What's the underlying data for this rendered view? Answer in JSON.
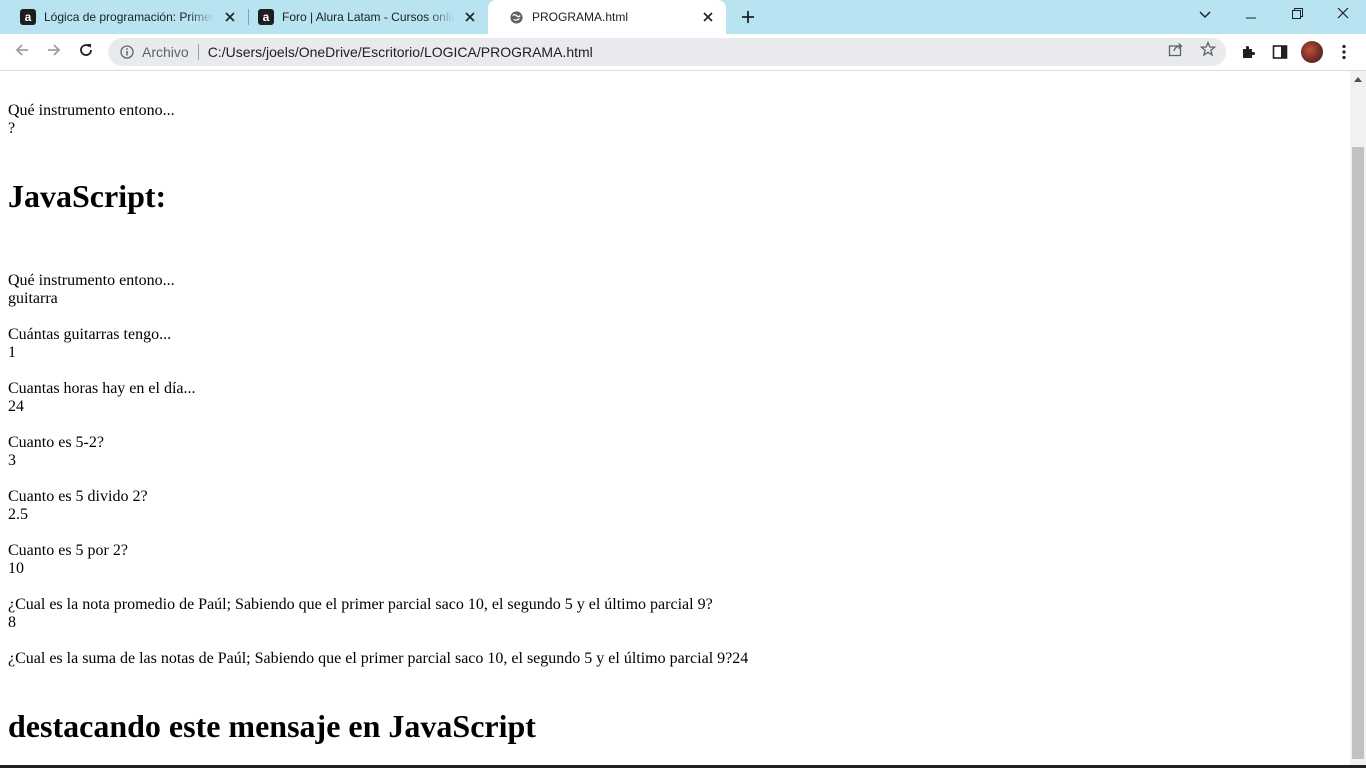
{
  "browser": {
    "tabs": [
      {
        "title": "Lógica de programación: Primeros pasos",
        "favicon": "alura-icon",
        "active": false
      },
      {
        "title": "Foro | Alura Latam - Cursos online",
        "favicon": "alura-icon",
        "active": false
      },
      {
        "title": "PROGRAMA.html",
        "favicon": "globe-icon",
        "active": true
      }
    ],
    "favicon_letter": "a",
    "address": {
      "chip": "Archivo",
      "url": "C:/Users/joels/OneDrive/Escritorio/LOGICA/PROGRAMA.html"
    },
    "colors": {
      "tabstrip": "#b8e4f2",
      "toolbar": "#ffffff",
      "omnibox": "#e8eaed"
    }
  },
  "page": {
    "lines": [
      "Qué instrumento entono...",
      "?",
      "Qué instrumento entono...",
      "guitarra",
      "Cuántas guitarras tengo...",
      "1",
      "Cuantas horas hay en el día...",
      "24",
      "Cuanto es 5-2?",
      "3",
      "Cuanto es 5 divido 2?",
      "2.5",
      "Cuanto es 5 por 2?",
      "10",
      "¿Cual es la nota promedio de Paúl; Sabiendo que el primer parcial saco 10, el segundo 5 y el último parcial 9?",
      "8",
      "¿Cual es la suma de las notas de Paúl; Sabiendo que el primer parcial saco 10, el segundo 5 y el último parcial 9?24"
    ],
    "headings": [
      "JavaScript:",
      "destacando este mensaje en JavaScript"
    ]
  }
}
